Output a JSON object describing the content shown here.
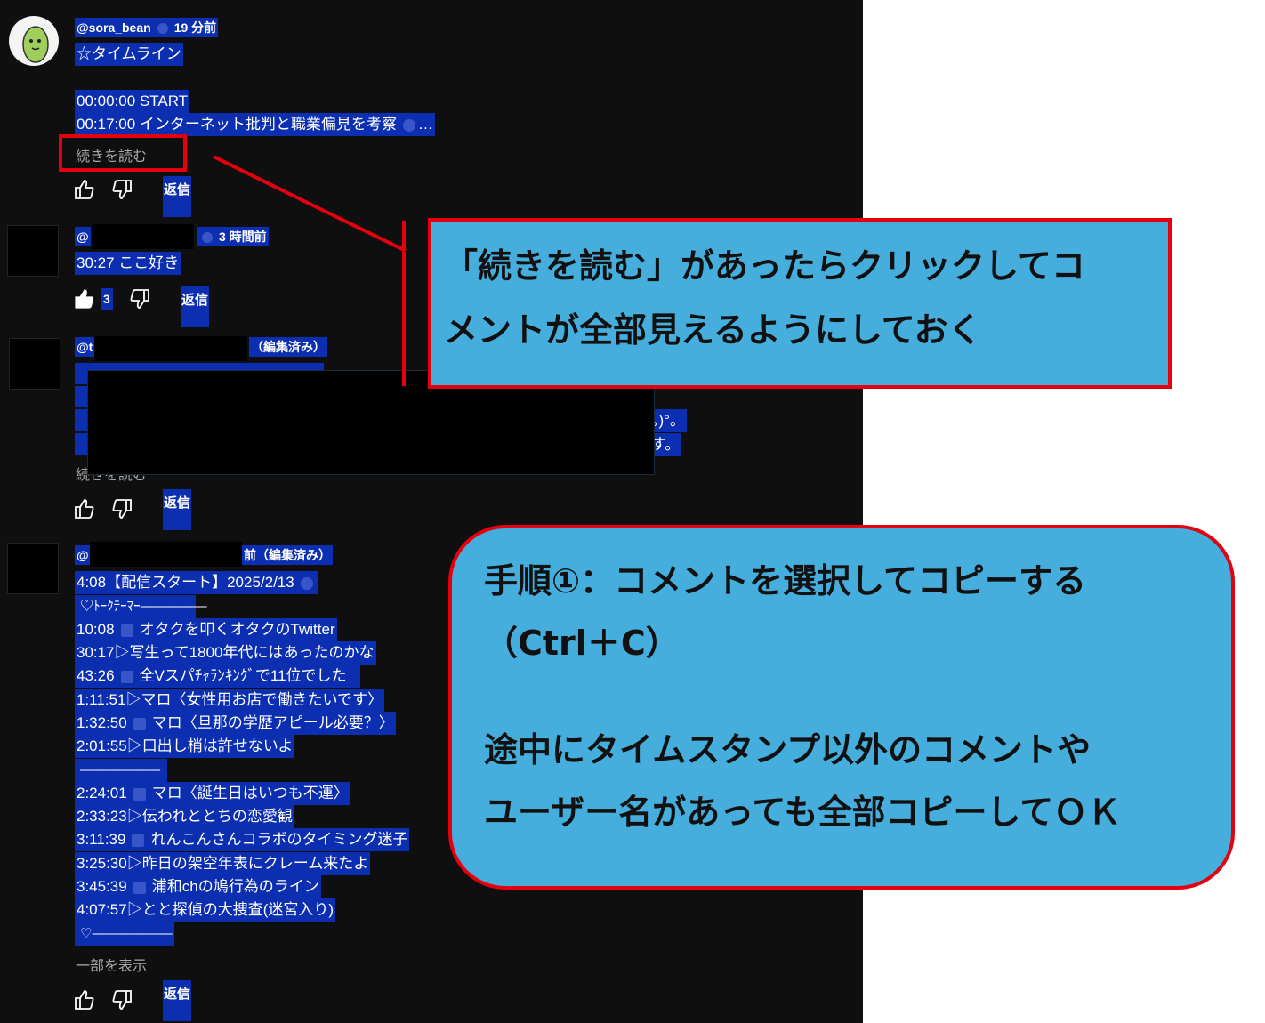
{
  "comments": [
    {
      "handle": "@sora_bean",
      "time": "19 分前",
      "lines": [
        "☆タイムライン",
        "",
        "00:00:00 START",
        "00:17:00 インターネット批判と職業偏見を考察"
      ],
      "read_more": "続きを読む",
      "reply": "返信"
    },
    {
      "handle": "@",
      "time": "3 時間前",
      "lines": [
        "30:27 ここ好き"
      ],
      "likes": "3",
      "reply": "返信"
    },
    {
      "handle": "@t",
      "edited": "（編集済み）",
      "tail1": "。)°。",
      "tail2": "す。",
      "read_more": "続きを読む",
      "reply": "返信"
    },
    {
      "handle": "@",
      "time": "前（編集済み）",
      "lines": [
        "4:08【配信スタート】2025/2/13",
        " ♡ﾄｰｸﾃｰﾏｰ―――――",
        "10:08",
        "オタクを叩くオタクのTwitter",
        "30:17▷写生って1800年代にはあったのかな",
        "43:26",
        "全Vスパﾁｬﾗﾝｷﾝｸﾞで11位でした",
        "1:11:51▷マロ〈女性用お店で働きたいです〉",
        "1:32:50",
        "マロ〈旦那の学歴アピール必要？〉",
        "2:01:55▷口出し梢は許せないよ",
        " ――――――",
        "2:24:01",
        "マロ〈誕生日はいつも不運〉",
        "2:33:23▷伝われととちの恋愛観",
        "3:11:39",
        "れんこんさんコラボのタイミング迷子",
        "3:25:30▷昨日の架空年表にクレーム来たよ",
        "3:45:39",
        "浦和chの鳩行為のライン",
        "4:07:57▷とと探偵の大捜査(迷宮入り)",
        " ♡――――――"
      ],
      "show_less": "一部を表示",
      "reply": "返信"
    }
  ],
  "callouts": {
    "top": [
      "「続きを読む」があったらクリックしてコ",
      "メントが全部見えるようにしておく"
    ],
    "bottom": [
      "手順①：コメントを選択してコピーする",
      "（Ctrl＋C）",
      "途中にタイムスタンプ以外のコメントや",
      "ユーザー名があっても全部コピーしてＯＫ"
    ]
  },
  "colors": {
    "selection": "#0b2fb0",
    "callout_bg": "#45aedd",
    "callout_border": "#e4000f",
    "panel_bg": "#0f0f0f"
  }
}
